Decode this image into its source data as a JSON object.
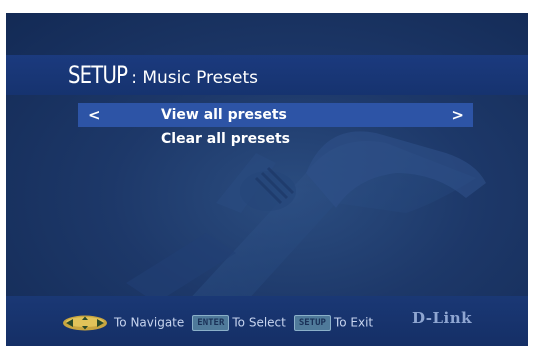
{
  "header": {
    "title_main": "SETUP",
    "title_sub": ": Music Presets"
  },
  "menu": {
    "items": [
      {
        "label": "View all presets",
        "selected": true
      },
      {
        "label": "Clear all presets",
        "selected": false
      }
    ],
    "left_arrow": "<",
    "right_arrow": ">"
  },
  "footer": {
    "navigate_label": "To Navigate",
    "enter_key": "ENTER",
    "select_label": "To Select",
    "setup_key": "SETUP",
    "exit_label": "To Exit",
    "brand": "D-Link"
  },
  "colors": {
    "background": "#1d3869",
    "title_bar": "#1b3a7e",
    "selection": "#2d54a6",
    "text": "#ffffff"
  },
  "icons": {
    "navigate": "directional-pad-icon"
  }
}
